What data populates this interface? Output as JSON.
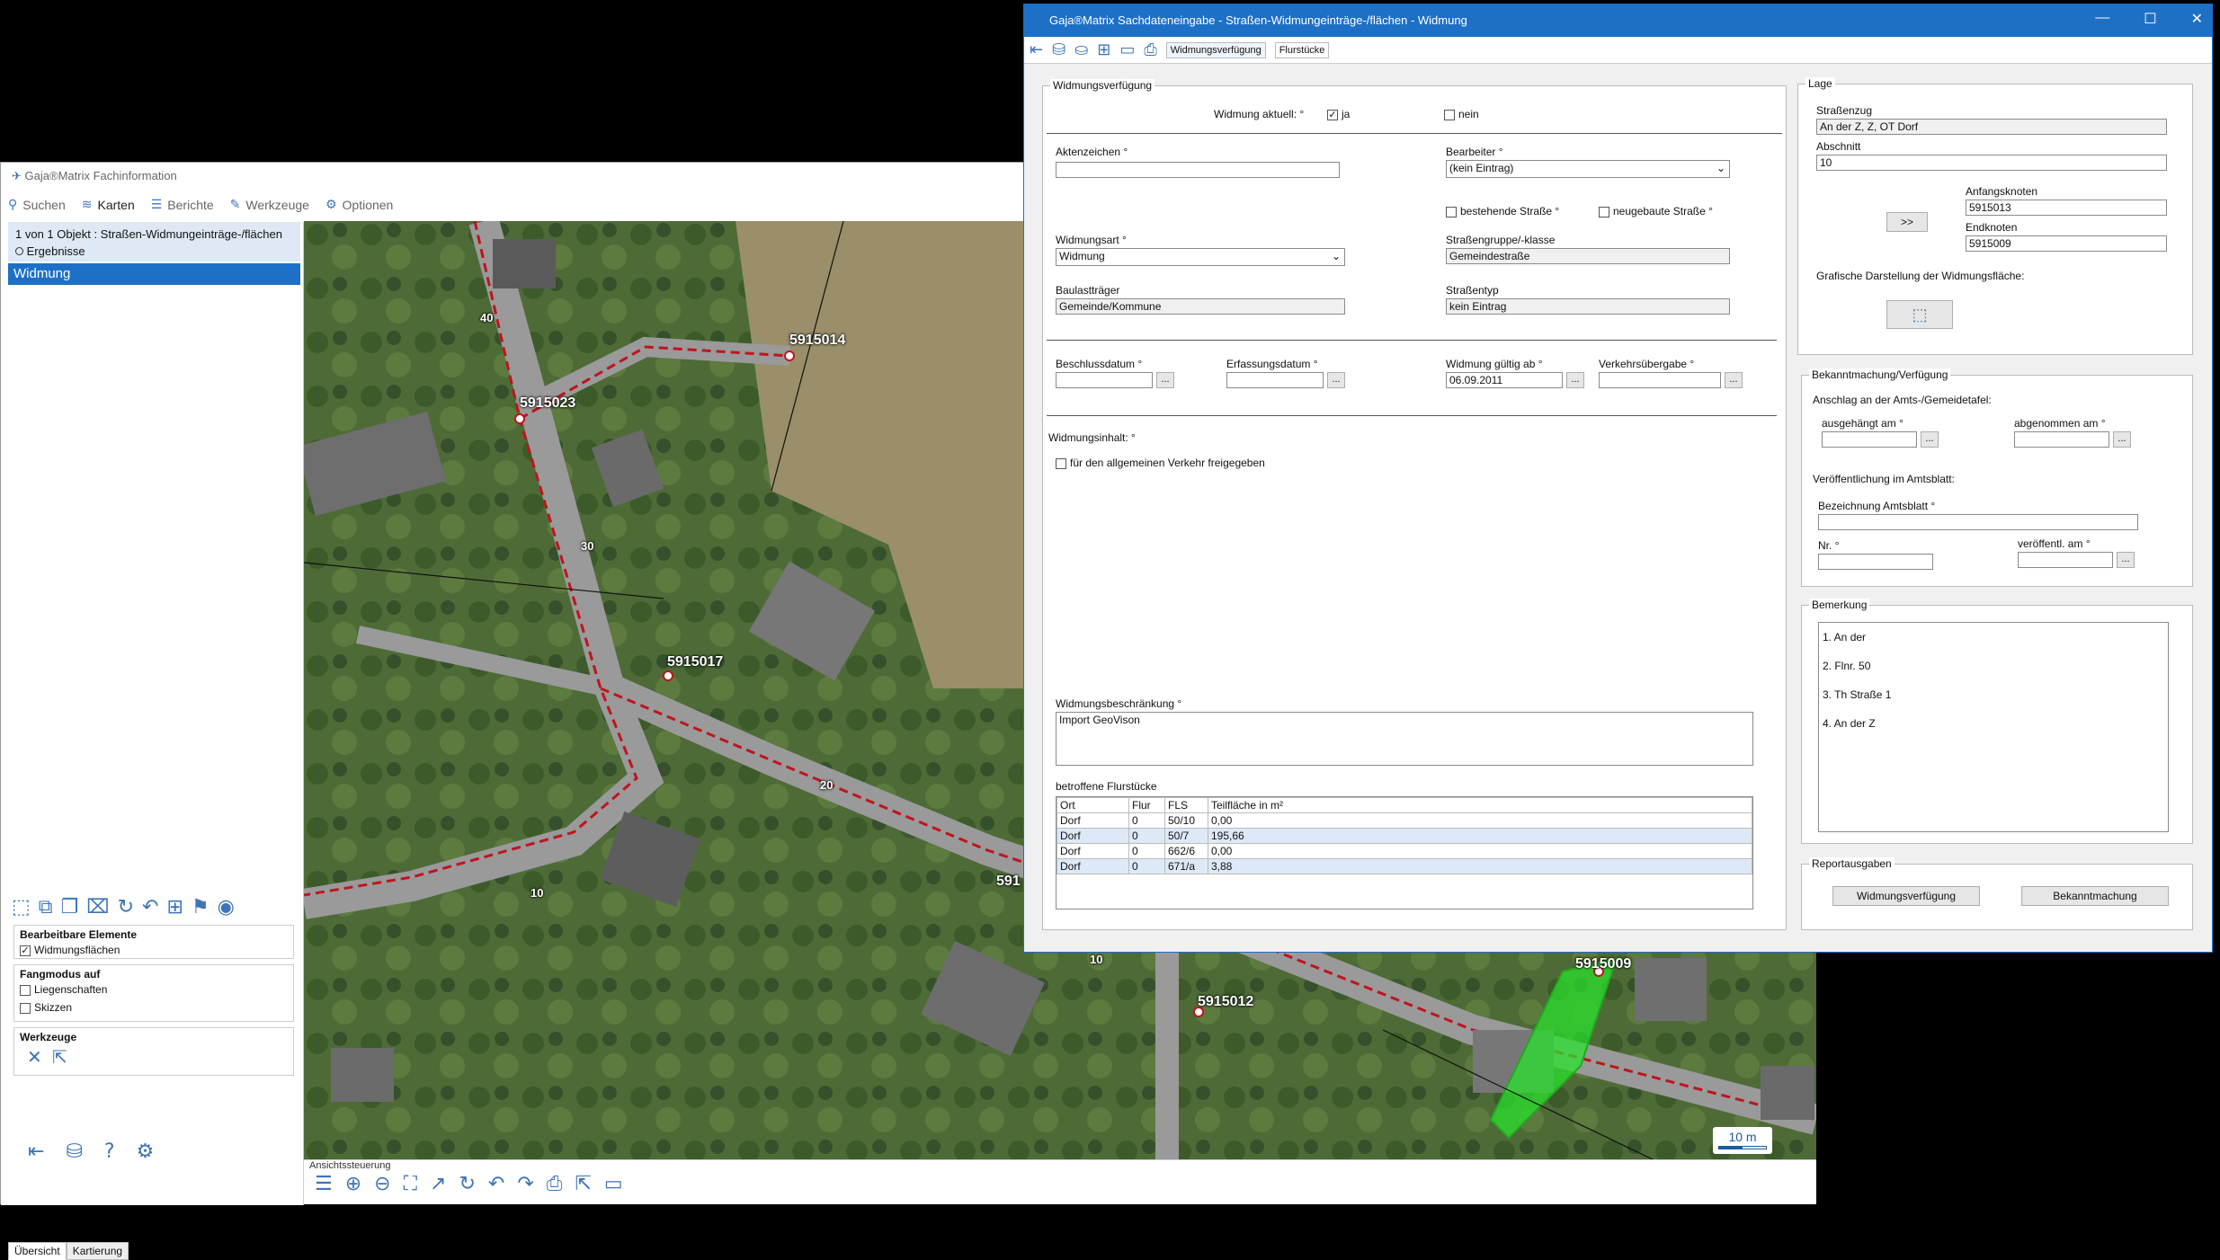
{
  "bg": {
    "title": "Gaja®Matrix Fachinformation",
    "menu": [
      "Suchen",
      "Karten",
      "Berichte",
      "Werkzeuge",
      "Optionen"
    ],
    "header_line1": "1 von 1 Objekt : Straßen-Widmungeinträge-/flächen",
    "header_line2": "Ergebnisse",
    "selected_item": "Widmung",
    "editable_title": "Bearbeitbare Elemente",
    "editable_item": "Widmungsflächen",
    "snap_title": "Fangmodus auf",
    "snap_items": [
      "Liegenschaften",
      "Skizzen"
    ],
    "tools_title": "Werkzeuge",
    "tabs": [
      "Übersicht",
      "Kartierung"
    ],
    "map_ctrl_label": "Ansichtssteuerung",
    "scale": "10 m",
    "map_nodes": [
      "5915014",
      "5915023",
      "5915017",
      "5915012",
      "5915009",
      "591"
    ],
    "map_numbers": [
      "40",
      "30",
      "20",
      "10",
      "10"
    ]
  },
  "dlg": {
    "title": "Gaja®Matrix Sachdateneingabe - Straßen-Widmungeinträge-/flächen - Widmung",
    "tabs": [
      "Widmungsverfügung",
      "Flurstücke"
    ],
    "vf": {
      "legend": "Widmungsverfügung",
      "aktuell_label": "Widmung aktuell: °",
      "ja": "ja",
      "nein": "nein",
      "akten_label": "Aktenzeichen °",
      "akten_value": "",
      "bearb_label": "Bearbeiter °",
      "bearb_value": "(kein Eintrag)",
      "bestehende": "bestehende Straße °",
      "neugebaute": "neugebaute Straße °",
      "art_label": "Widmungsart °",
      "art_value": "Widmung",
      "gruppe_label": "Straßengruppe/-klasse",
      "gruppe_value": "Gemeindestraße",
      "traeger_label": "Baulastträger",
      "traeger_value": "Gemeinde/Kommune",
      "typ_label": "Straßentyp",
      "typ_value": "kein Eintrag",
      "beschluss_label": "Beschlussdatum °",
      "erfassung_label": "Erfassungsdatum °",
      "gueltig_label": "Widmung gültig ab °",
      "gueltig_value": "06.09.2011",
      "uebergabe_label": "Verkehrsübergabe °",
      "inhalt_label": "Widmungsinhalt: °",
      "inhalt_cb": "für den allgemeinen Verkehr freigegeben",
      "beschr_label": "Widmungsbeschränkung °",
      "beschr_value": "Import GeoVison",
      "flur_label": "betroffene Flurstücke",
      "flur_cols": [
        "Ort",
        "Flur",
        "FLS",
        "Teilfläche in m²"
      ],
      "flur_rows": [
        [
          "Dorf",
          "0",
          "50/10",
          "0,00"
        ],
        [
          "Dorf",
          "0",
          "50/7",
          "195,66"
        ],
        [
          "Dorf",
          "0",
          "662/6",
          "0,00"
        ],
        [
          "Dorf",
          "0",
          "671/a",
          "3,88"
        ]
      ]
    },
    "lage": {
      "legend": "Lage",
      "zug_label": "Straßenzug",
      "zug_value": "An der Z, Z, OT Dorf",
      "abschnitt_label": "Abschnitt",
      "abschnitt_value": "10",
      "anfang_label": "Anfangsknoten",
      "anfang_value": "5915013",
      "end_label": "Endknoten",
      "end_value": "5915009",
      "swap_btn": ">>",
      "grafik_label": "Grafische Darstellung der Widmungsfläche:"
    },
    "bek": {
      "legend": "Bekanntmachung/Verfügung",
      "anschlag_label": "Anschlag an der Amts-/Gemeidetafel:",
      "ausgehaengt_label": "ausgehängt am °",
      "abgenommen_label": "abgenommen am °",
      "veroeff_label": "Veröffentlichung im Amtsblatt:",
      "bez_label": "Bezeichnung Amtsblatt °",
      "nr_label": "Nr. °",
      "veroeffam_label": "veröffentl. am °"
    },
    "bem": {
      "legend": "Bemerkung",
      "lines": [
        "1. An der",
        "2. Flnr. 50",
        "3. Th Straße 1",
        "4. An der Z"
      ]
    },
    "rep": {
      "legend": "Reportausgaben",
      "btn1": "Widmungsverfügung",
      "btn2": "Bekanntmachung"
    },
    "dots": "..."
  }
}
